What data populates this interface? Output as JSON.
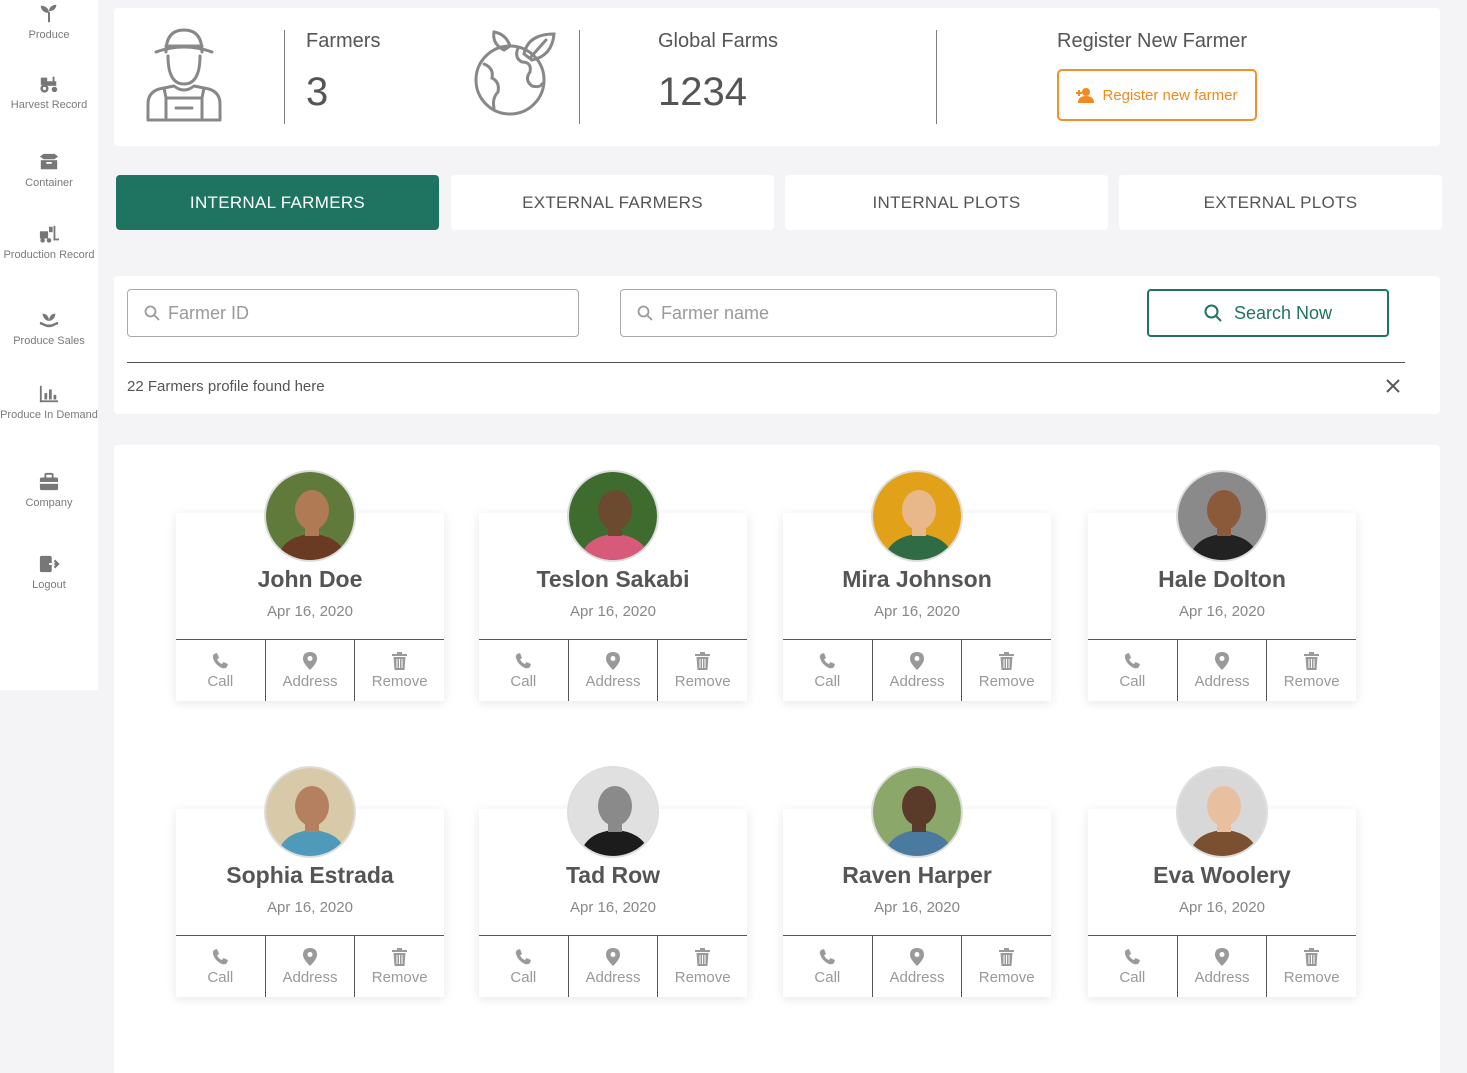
{
  "sidebar": {
    "items": [
      {
        "label": "Produce",
        "icon": "sprout-icon"
      },
      {
        "label": "Harvest Record",
        "icon": "tractor-icon"
      },
      {
        "label": "Container",
        "icon": "box-icon"
      },
      {
        "label": "Production Record",
        "icon": "forklift-icon"
      },
      {
        "label": "Produce Sales",
        "icon": "plant-hand-icon"
      },
      {
        "label": "Produce In Demand",
        "icon": "bar-chart-icon"
      },
      {
        "label": "Company",
        "icon": "briefcase-icon"
      },
      {
        "label": "Logout",
        "icon": "logout-icon"
      }
    ]
  },
  "header": {
    "farmers_label": "Farmers",
    "farmers_count": "3",
    "global_label": "Global Farms",
    "global_count": "1234",
    "register_label": "Register New Farmer",
    "register_button": "Register new farmer"
  },
  "tabs": [
    {
      "label": "INTERNAL FARMERS",
      "active": true
    },
    {
      "label": "EXTERNAL FARMERS",
      "active": false
    },
    {
      "label": "INTERNAL PLOTS",
      "active": false
    },
    {
      "label": "EXTERNAL PLOTS",
      "active": false
    }
  ],
  "search": {
    "id_placeholder": "Farmer ID",
    "name_placeholder": "Farmer name",
    "button": "Search Now",
    "result_text": "22 Farmers profile found here"
  },
  "actions": {
    "call": "Call",
    "address": "Address",
    "remove": "Remove"
  },
  "farmers": [
    {
      "name": "John Doe",
      "date": "Apr 16, 2020"
    },
    {
      "name": "Teslon Sakabi",
      "date": "Apr 16, 2020"
    },
    {
      "name": "Mira Johnson",
      "date": "Apr 16, 2020"
    },
    {
      "name": "Hale Dolton",
      "date": "Apr 16, 2020"
    },
    {
      "name": "Sophia Estrada",
      "date": "Apr 16, 2020"
    },
    {
      "name": "Tad Row",
      "date": "Apr 16, 2020"
    },
    {
      "name": "Raven Harper",
      "date": "Apr 16, 2020"
    },
    {
      "name": "Eva Woolery",
      "date": "Apr 16, 2020"
    }
  ],
  "colors": {
    "primary": "#1e7461",
    "accent": "#ef8a1e"
  }
}
